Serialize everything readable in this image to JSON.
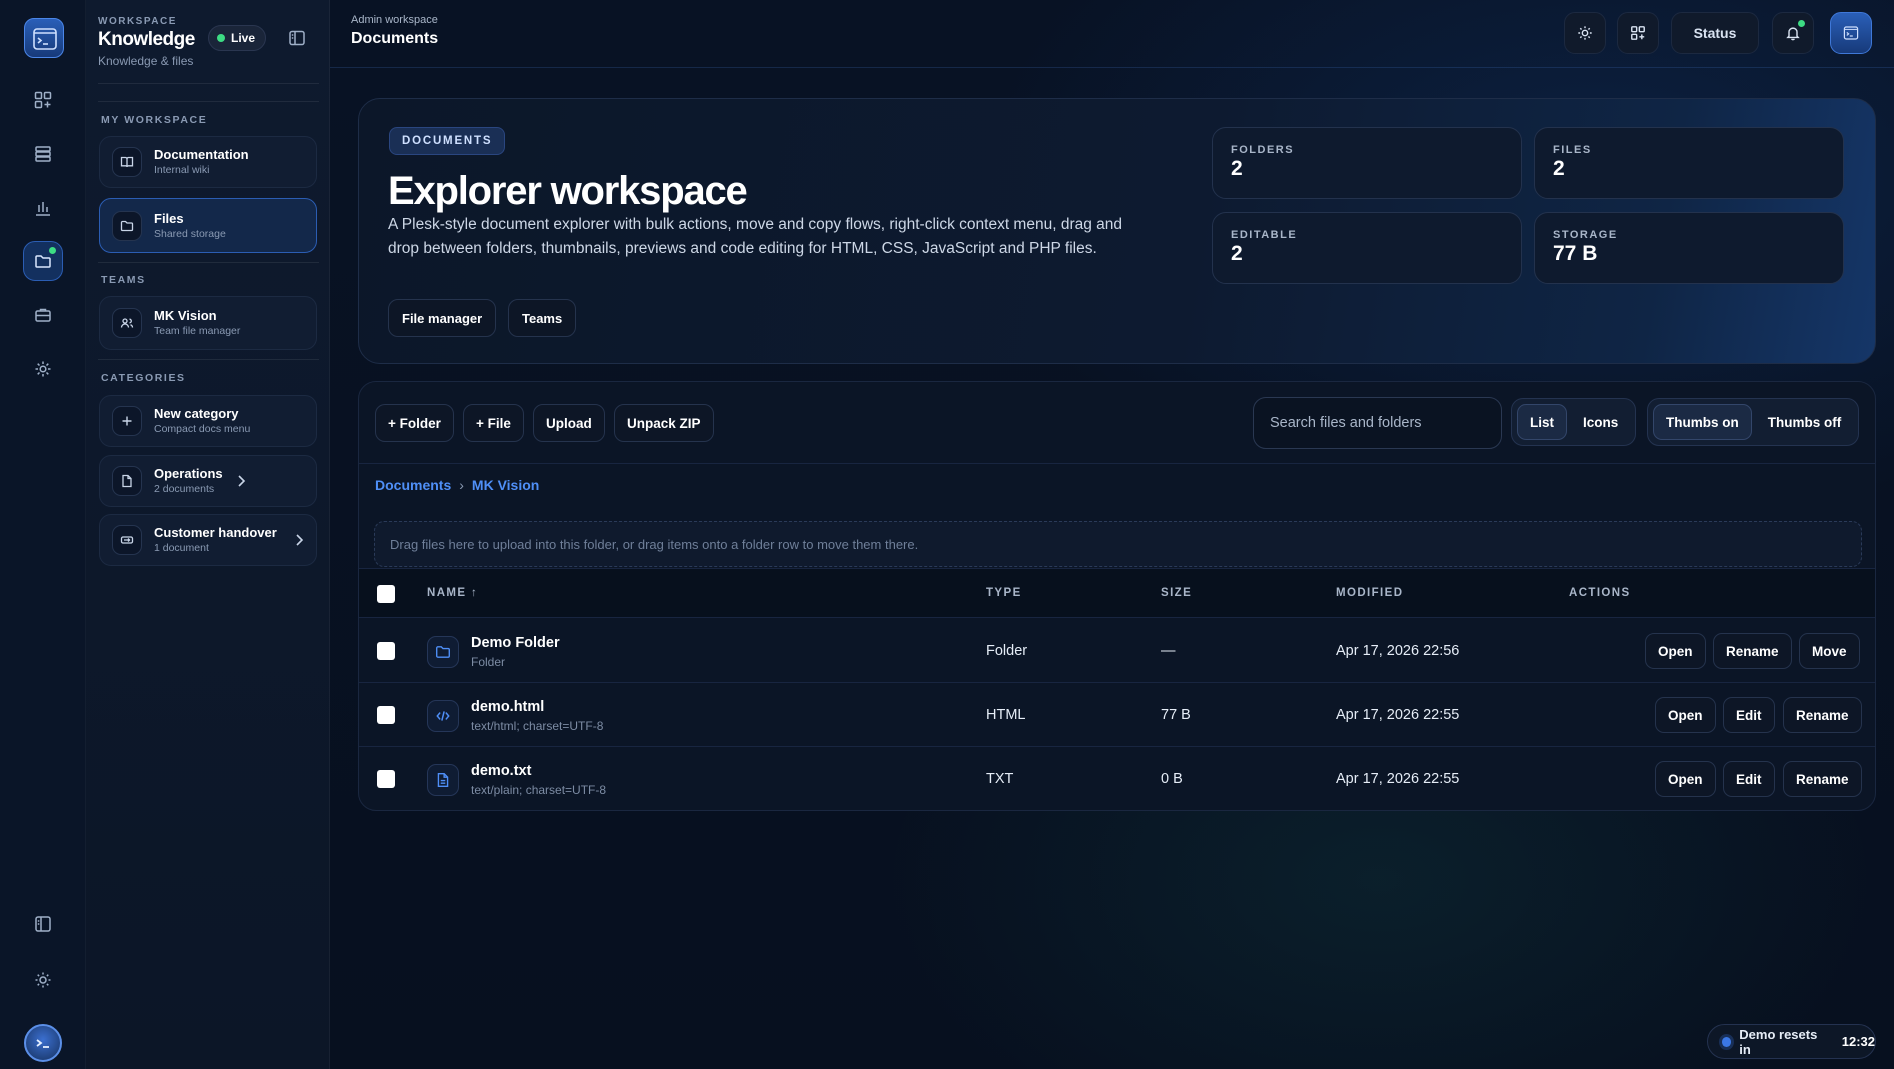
{
  "rail": {
    "icons": [
      "terminal-logo-icon",
      "dashboard-grid-icon",
      "server-icon",
      "chart-icon",
      "folder-icon",
      "briefcase-icon",
      "gear-icon",
      "sidebar-toggle-icon",
      "sun-icon",
      "avatar"
    ]
  },
  "sidebar": {
    "eyebrow": "WORKSPACE",
    "title": "Knowledge",
    "subtitle": "Knowledge & files",
    "live_label": "Live",
    "section_my": "MY WORKSPACE",
    "section_teams": "TEAMS",
    "section_categories": "CATEGORIES",
    "items": [
      {
        "label": "Documentation",
        "sub": "Internal wiki"
      },
      {
        "label": "Files",
        "sub": "Shared storage"
      },
      {
        "label": "MK Vision",
        "sub": "Team file manager"
      },
      {
        "label": "New category",
        "sub": "Compact docs menu"
      },
      {
        "label": "Operations",
        "sub": "2 documents"
      },
      {
        "label": "Customer handover",
        "sub": "1 document"
      }
    ]
  },
  "topbar": {
    "eyebrow": "Admin workspace",
    "title": "Documents",
    "status_label": "Status"
  },
  "hero": {
    "badge": "DOCUMENTS",
    "title": "Explorer workspace",
    "description": "A Plesk-style document explorer with bulk actions, move and copy flows, right-click context menu, drag and drop between folders, thumbnails, previews and code editing for HTML, CSS, JavaScript and PHP files.",
    "buttons": [
      "File manager",
      "Teams"
    ],
    "stats": [
      {
        "label": "FOLDERS",
        "value": "2"
      },
      {
        "label": "FILES",
        "value": "2"
      },
      {
        "label": "EDITABLE",
        "value": "2"
      },
      {
        "label": "STORAGE",
        "value": "77 B"
      }
    ]
  },
  "toolbar": {
    "new_folder": "+ Folder",
    "new_file": "+ File",
    "upload": "Upload",
    "unpack": "Unpack ZIP",
    "search_placeholder": "Search files and folders",
    "view_list": "List",
    "view_icons": "Icons",
    "thumbs_on": "Thumbs on",
    "thumbs_off": "Thumbs off"
  },
  "breadcrumb": {
    "root": "Documents",
    "sep": "›",
    "current": "MK Vision"
  },
  "dropzone": "Drag files here to upload into this folder, or drag items onto a folder row to move them there.",
  "table": {
    "headers": {
      "name": "NAME ↑",
      "type": "TYPE",
      "size": "SIZE",
      "modified": "MODIFIED",
      "actions": "ACTIONS"
    },
    "rows": [
      {
        "name": "Demo Folder",
        "sub": "Folder",
        "type": "Folder",
        "size": "—",
        "modified": "Apr 17, 2026 22:56",
        "icon": "folder-icon",
        "actions": [
          "Open",
          "Rename",
          "Move"
        ]
      },
      {
        "name": "demo.html",
        "sub": "text/html; charset=UTF-8",
        "type": "HTML",
        "size": "77 B",
        "modified": "Apr 17, 2026 22:55",
        "icon": "code-icon",
        "actions": [
          "Open",
          "Edit",
          "Rename"
        ]
      },
      {
        "name": "demo.txt",
        "sub": "text/plain; charset=UTF-8",
        "type": "TXT",
        "size": "0 B",
        "modified": "Apr 17, 2026 22:55",
        "icon": "text-file-icon",
        "actions": [
          "Open",
          "Edit",
          "Rename"
        ]
      }
    ]
  },
  "footer": {
    "reset_label": "Demo resets in",
    "reset_time": "12:32"
  },
  "colors": {
    "accent": "#4f8ff7",
    "live": "#3ddc84",
    "background": "#07101f"
  }
}
